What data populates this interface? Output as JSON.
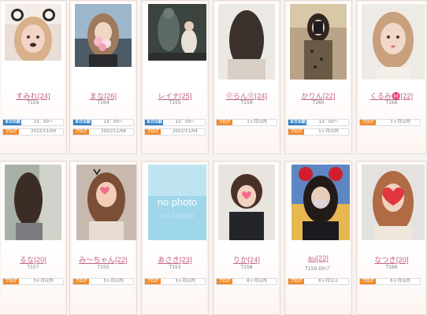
{
  "labels": {
    "work_tag": "本日出勤",
    "blog_tag": "ブログ"
  },
  "colors": {
    "name": "#c05f86",
    "work_tag": "#2f7ec5",
    "blog_tag": "#f18b2b"
  },
  "row1": [
    {
      "name": "すみれ[24]",
      "height": "T159",
      "shift": "13：00～",
      "blog": "2022/11/09",
      "photo": "photo-selfie-dog-filter"
    },
    {
      "name": "まな[26]",
      "height": "T164",
      "shift": "13：00～",
      "blog": "2022/11/08",
      "photo": "photo-flowers-face"
    },
    {
      "name": "レイナ[25]",
      "height": "T155",
      "shift": "12：00～",
      "blog": "2022/11/04",
      "photo": "photo-statue-night"
    },
    {
      "name": "❀らん❀[24]",
      "height": "T159",
      "shift": "",
      "blog": "1ヶ月以内",
      "photo": "photo-back-hair"
    },
    {
      "name": "かりん[22]",
      "height": "T160",
      "shift": "13：00～",
      "blog": "1ヶ月以内",
      "photo": "photo-mirror-selfie"
    },
    {
      "name": "くるみ♓[22]",
      "height": "T166",
      "shift": "",
      "blog": "1ヶ月以内",
      "photo": "photo-portrait-blonde"
    }
  ],
  "row2": [
    {
      "name": "るな[20]",
      "height": "T157",
      "blog": "3ヶ月以内",
      "photo": "photo-salon-hair"
    },
    {
      "name": "み～ちゃん[22]",
      "height": "T155",
      "blog": "3ヶ月以内",
      "photo": "photo-heart-filter"
    },
    {
      "name": "あさき[23]",
      "height": "T153",
      "blog": "3ヶ月以内",
      "photo": "no-photo-placeholder",
      "placeholder_text": "no photo"
    },
    {
      "name": "りか[24]",
      "height": "T158",
      "blog": "6ヶ月以内",
      "photo": "photo-bob-hair"
    },
    {
      "name": "au[22]",
      "height": "T150 Dｶｯﾌﾟ",
      "blog": "6ヶ月以上",
      "photo": "photo-mask-ears"
    },
    {
      "name": "なつき[20]",
      "height": "T166",
      "blog": "6ヶ月以内",
      "photo": "photo-red-heart"
    }
  ]
}
